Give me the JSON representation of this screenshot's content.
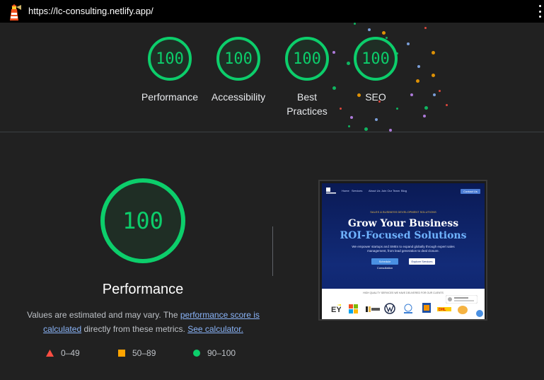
{
  "topbar": {
    "url": "https://lc-consulting.netlify.app/",
    "logo_icon": "lighthouse-icon",
    "menu_icon": "kebab-menu-icon"
  },
  "header": {
    "gauges": [
      {
        "score": "100",
        "label": "Performance"
      },
      {
        "score": "100",
        "label": "Accessibility"
      },
      {
        "score": "100",
        "label": "Best Practices"
      },
      {
        "score": "100",
        "label": "SEO"
      }
    ]
  },
  "colors": {
    "pass": "#0cce6b",
    "average": "#ffa400",
    "fail": "#ff4e42",
    "link": "#8ab4f8",
    "background": "#212121"
  },
  "main": {
    "score": "100",
    "title": "Performance",
    "desc_prefix": "Values are estimated and may vary. The",
    "desc_link1": "performance score is calculated",
    "desc_middle": "directly from these metrics.",
    "desc_link2": "See calculator.",
    "legend": [
      {
        "icon": "triangle-icon",
        "range": "0–49"
      },
      {
        "icon": "square-icon",
        "range": "50–89"
      },
      {
        "icon": "circle-icon",
        "range": "90–100"
      }
    ]
  },
  "screenshot": {
    "nav_items": [
      "Home",
      "Services",
      "About Us",
      "Join Our Team",
      "Blog"
    ],
    "nav_button": "Contact Us",
    "tagline": "SALES & BUSINESS DEVELOPMENT SOLUTIONS",
    "headline1": "Grow Your Business",
    "headline2": "ROI-Focused Solutions",
    "paragraph": "We empower startups and SMEs to expand globally through expert sales management, from lead generation to deal closure.",
    "button1": "Schedule Consultation",
    "button2": "Explore Services",
    "logos_caption": "HIGH QUALITY SERVICES WE HAVE DELIVERED FOR OUR CLIENTS"
  }
}
